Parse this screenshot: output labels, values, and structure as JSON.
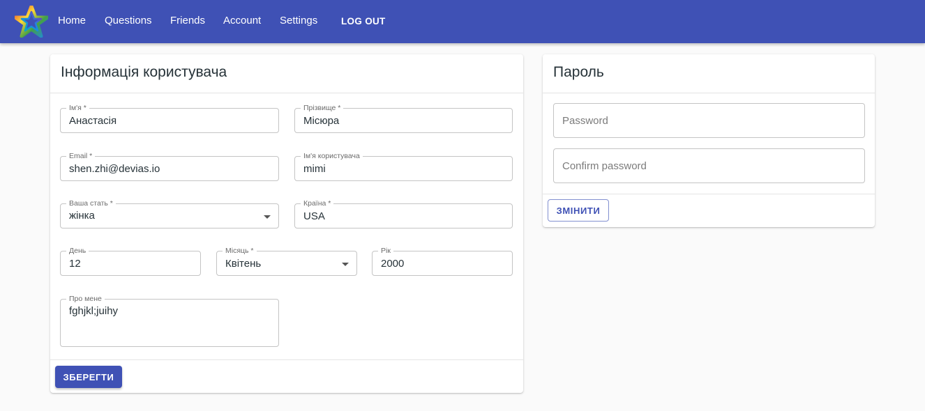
{
  "nav": {
    "items": [
      "Home",
      "Questions",
      "Friends",
      "Account",
      "Settings"
    ],
    "logout": "LOG OUT"
  },
  "profile": {
    "title": "Інформація користувача",
    "first_name": {
      "label": "Ім'я *",
      "value": "Анастасія"
    },
    "last_name": {
      "label": "Прізвище *",
      "value": "Місюра"
    },
    "email": {
      "label": "Email *",
      "value": "shen.zhi@devias.io"
    },
    "username": {
      "label": "Ім'я користувача",
      "value": "mimi"
    },
    "gender": {
      "label": "Ваша стать *",
      "value": "жінка"
    },
    "country": {
      "label": "Країна *",
      "value": "USA"
    },
    "day": {
      "label": "День",
      "value": "12"
    },
    "month": {
      "label": "Місяць *",
      "value": "Квітень"
    },
    "year": {
      "label": "Рік",
      "value": "2000"
    },
    "about": {
      "label": "Про мене",
      "value": "fghjkl;juihy"
    },
    "save_label": "ЗБЕРЕГТИ"
  },
  "password": {
    "title": "Пароль",
    "password_placeholder": "Password",
    "confirm_placeholder": "Confirm password",
    "change_label": "ЗМІНИТИ"
  },
  "colors": {
    "primary": "#3f51b5"
  }
}
